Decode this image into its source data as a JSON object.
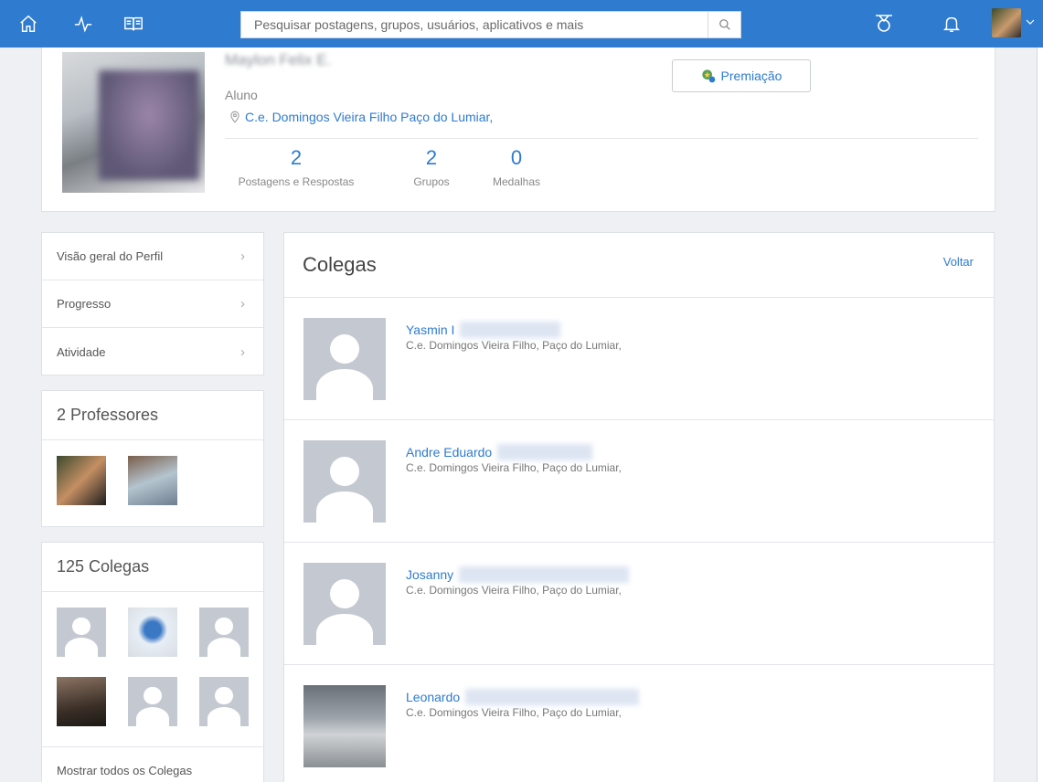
{
  "topbar": {
    "search_placeholder": "Pesquisar postagens, grupos, usuários, aplicativos e mais",
    "icons": [
      "home-icon",
      "activity-icon",
      "book-icon",
      "rewards-icon",
      "bell-icon"
    ]
  },
  "profile": {
    "name": "Maylon Felix E.",
    "role": "Aluno",
    "school": "C.e. Domingos Vieira Filho Paço do Lumiar,",
    "award_label": "Premiação",
    "stats": [
      {
        "value": "2",
        "label": "Postagens e Respostas"
      },
      {
        "value": "2",
        "label": "Grupos"
      },
      {
        "value": "0",
        "label": "Medalhas"
      }
    ]
  },
  "sidebar": {
    "menu": [
      {
        "label": "Visão geral do Perfil"
      },
      {
        "label": "Progresso"
      },
      {
        "label": "Atividade"
      }
    ],
    "teachers_title": "2 Professores",
    "classmates_title": "125 Colegas",
    "show_all_label": "Mostrar todos os Colegas"
  },
  "main": {
    "title": "Colegas",
    "back_label": "Voltar",
    "classmates": [
      {
        "name": "Yasmin I",
        "school": "C.e. Domingos Vieira Filho, Paço do Lumiar,"
      },
      {
        "name": "Andre Eduardo",
        "school": "C.e. Domingos Vieira Filho, Paço do Lumiar,"
      },
      {
        "name": "Josanny",
        "school": "C.e. Domingos Vieira Filho, Paço do Lumiar,"
      },
      {
        "name": "Leonardo",
        "school": "C.e. Domingos Vieira Filho, Paço do Lumiar,"
      }
    ]
  }
}
